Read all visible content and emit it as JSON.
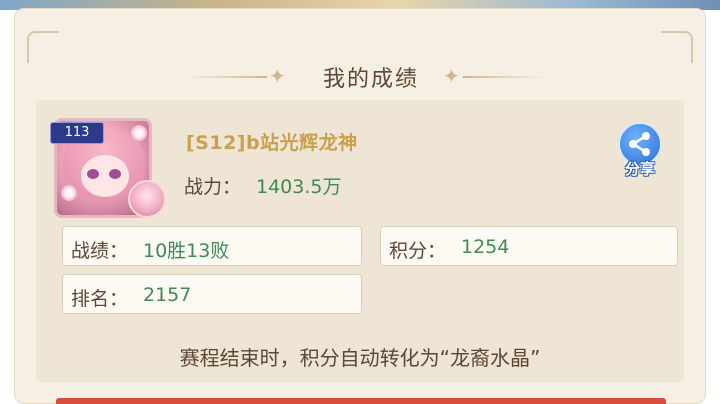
{
  "header": {
    "title": "我的成绩"
  },
  "player": {
    "level": "113",
    "name": "[S12]b站光辉龙神",
    "power_label": "战力：",
    "power_value": "1403.5万"
  },
  "share": {
    "label": "分享",
    "icon": "share-icon"
  },
  "stats": {
    "record_label": "战绩：",
    "record_value": "10胜13败",
    "points_label": "积分：",
    "points_value": "1254",
    "rank_label": "排名：",
    "rank_value": "2157"
  },
  "note": "赛程结束时，积分自动转化为“龙裔水晶”",
  "colors": {
    "panel_bg": "#f6efe3",
    "card_bg": "#efe5d4",
    "text_brown": "#5c4634",
    "value_green": "#3e8a55",
    "name_gold": "#c9a04b",
    "share_blue": "#2e6fd1",
    "level_badge": "#2b3b8a"
  }
}
